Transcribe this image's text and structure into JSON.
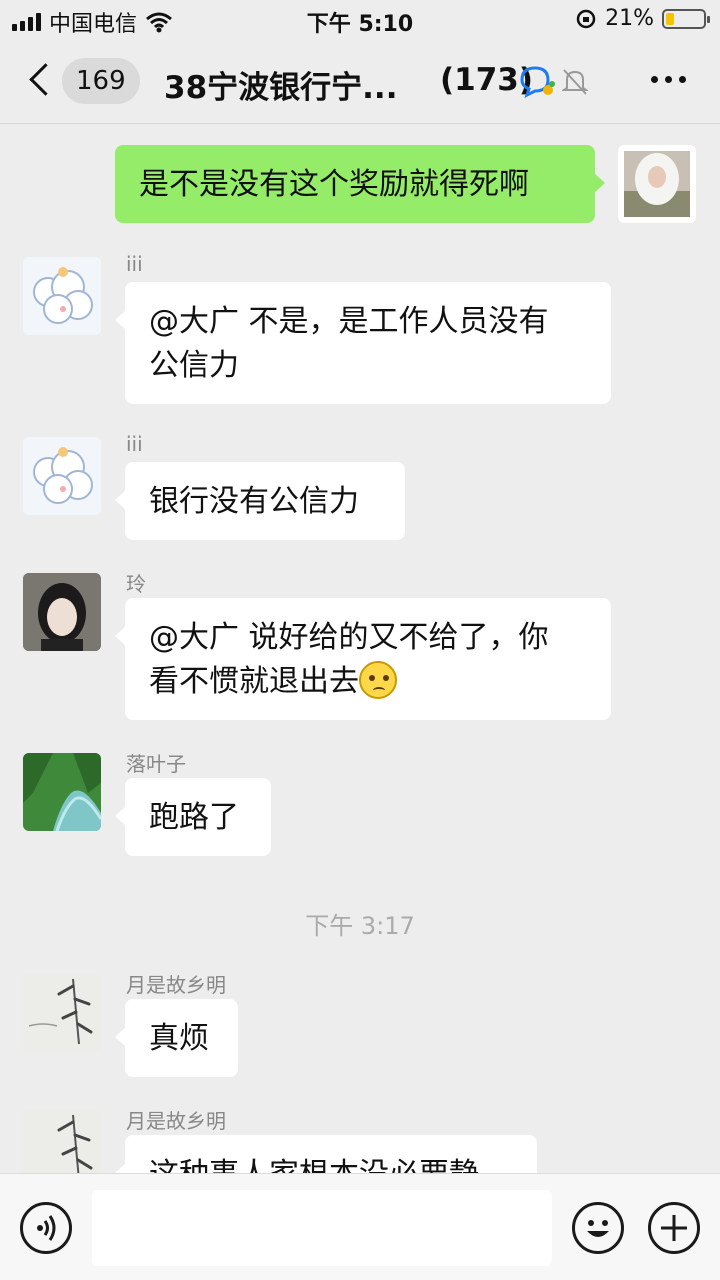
{
  "status_bar": {
    "carrier": "中国电信",
    "time": "下午 5:10",
    "battery": "21%",
    "battery_level": 0.21
  },
  "nav": {
    "unread_count": "169",
    "title": "38宁波银行宁...",
    "member_count": "(173)"
  },
  "messages": [
    {
      "side": "right",
      "text": "是不是没有这个奖励就得死啊"
    },
    {
      "side": "left",
      "sender": "iii",
      "line1": "@大广 不是，是工作人员没有",
      "line2": "公信力"
    },
    {
      "side": "left",
      "sender": "iii",
      "text": "银行没有公信力"
    },
    {
      "side": "left",
      "sender": "玲",
      "line1": "@大广 说好给的又不给了，你",
      "line2": "看不惯就退出去",
      "emoji": "woozy-face"
    },
    {
      "side": "left",
      "sender": "落叶子",
      "text": "跑路了"
    },
    {
      "type": "time",
      "text": "下午 3:17"
    },
    {
      "side": "left",
      "sender": "月是故乡明",
      "text": "真烦"
    },
    {
      "side": "left",
      "sender": "月是故乡明",
      "text": "这种事人家根本没必要静"
    }
  ],
  "input": {
    "placeholder": ""
  },
  "icons": [
    "back-icon",
    "chat-ai-icon",
    "mute-bell-icon",
    "more-icon",
    "voice-icon",
    "emoji-icon",
    "plus-icon"
  ],
  "colors": {
    "background": "#ededed",
    "sent_bubble": "#95ec69",
    "received_bubble": "#ffffff"
  }
}
